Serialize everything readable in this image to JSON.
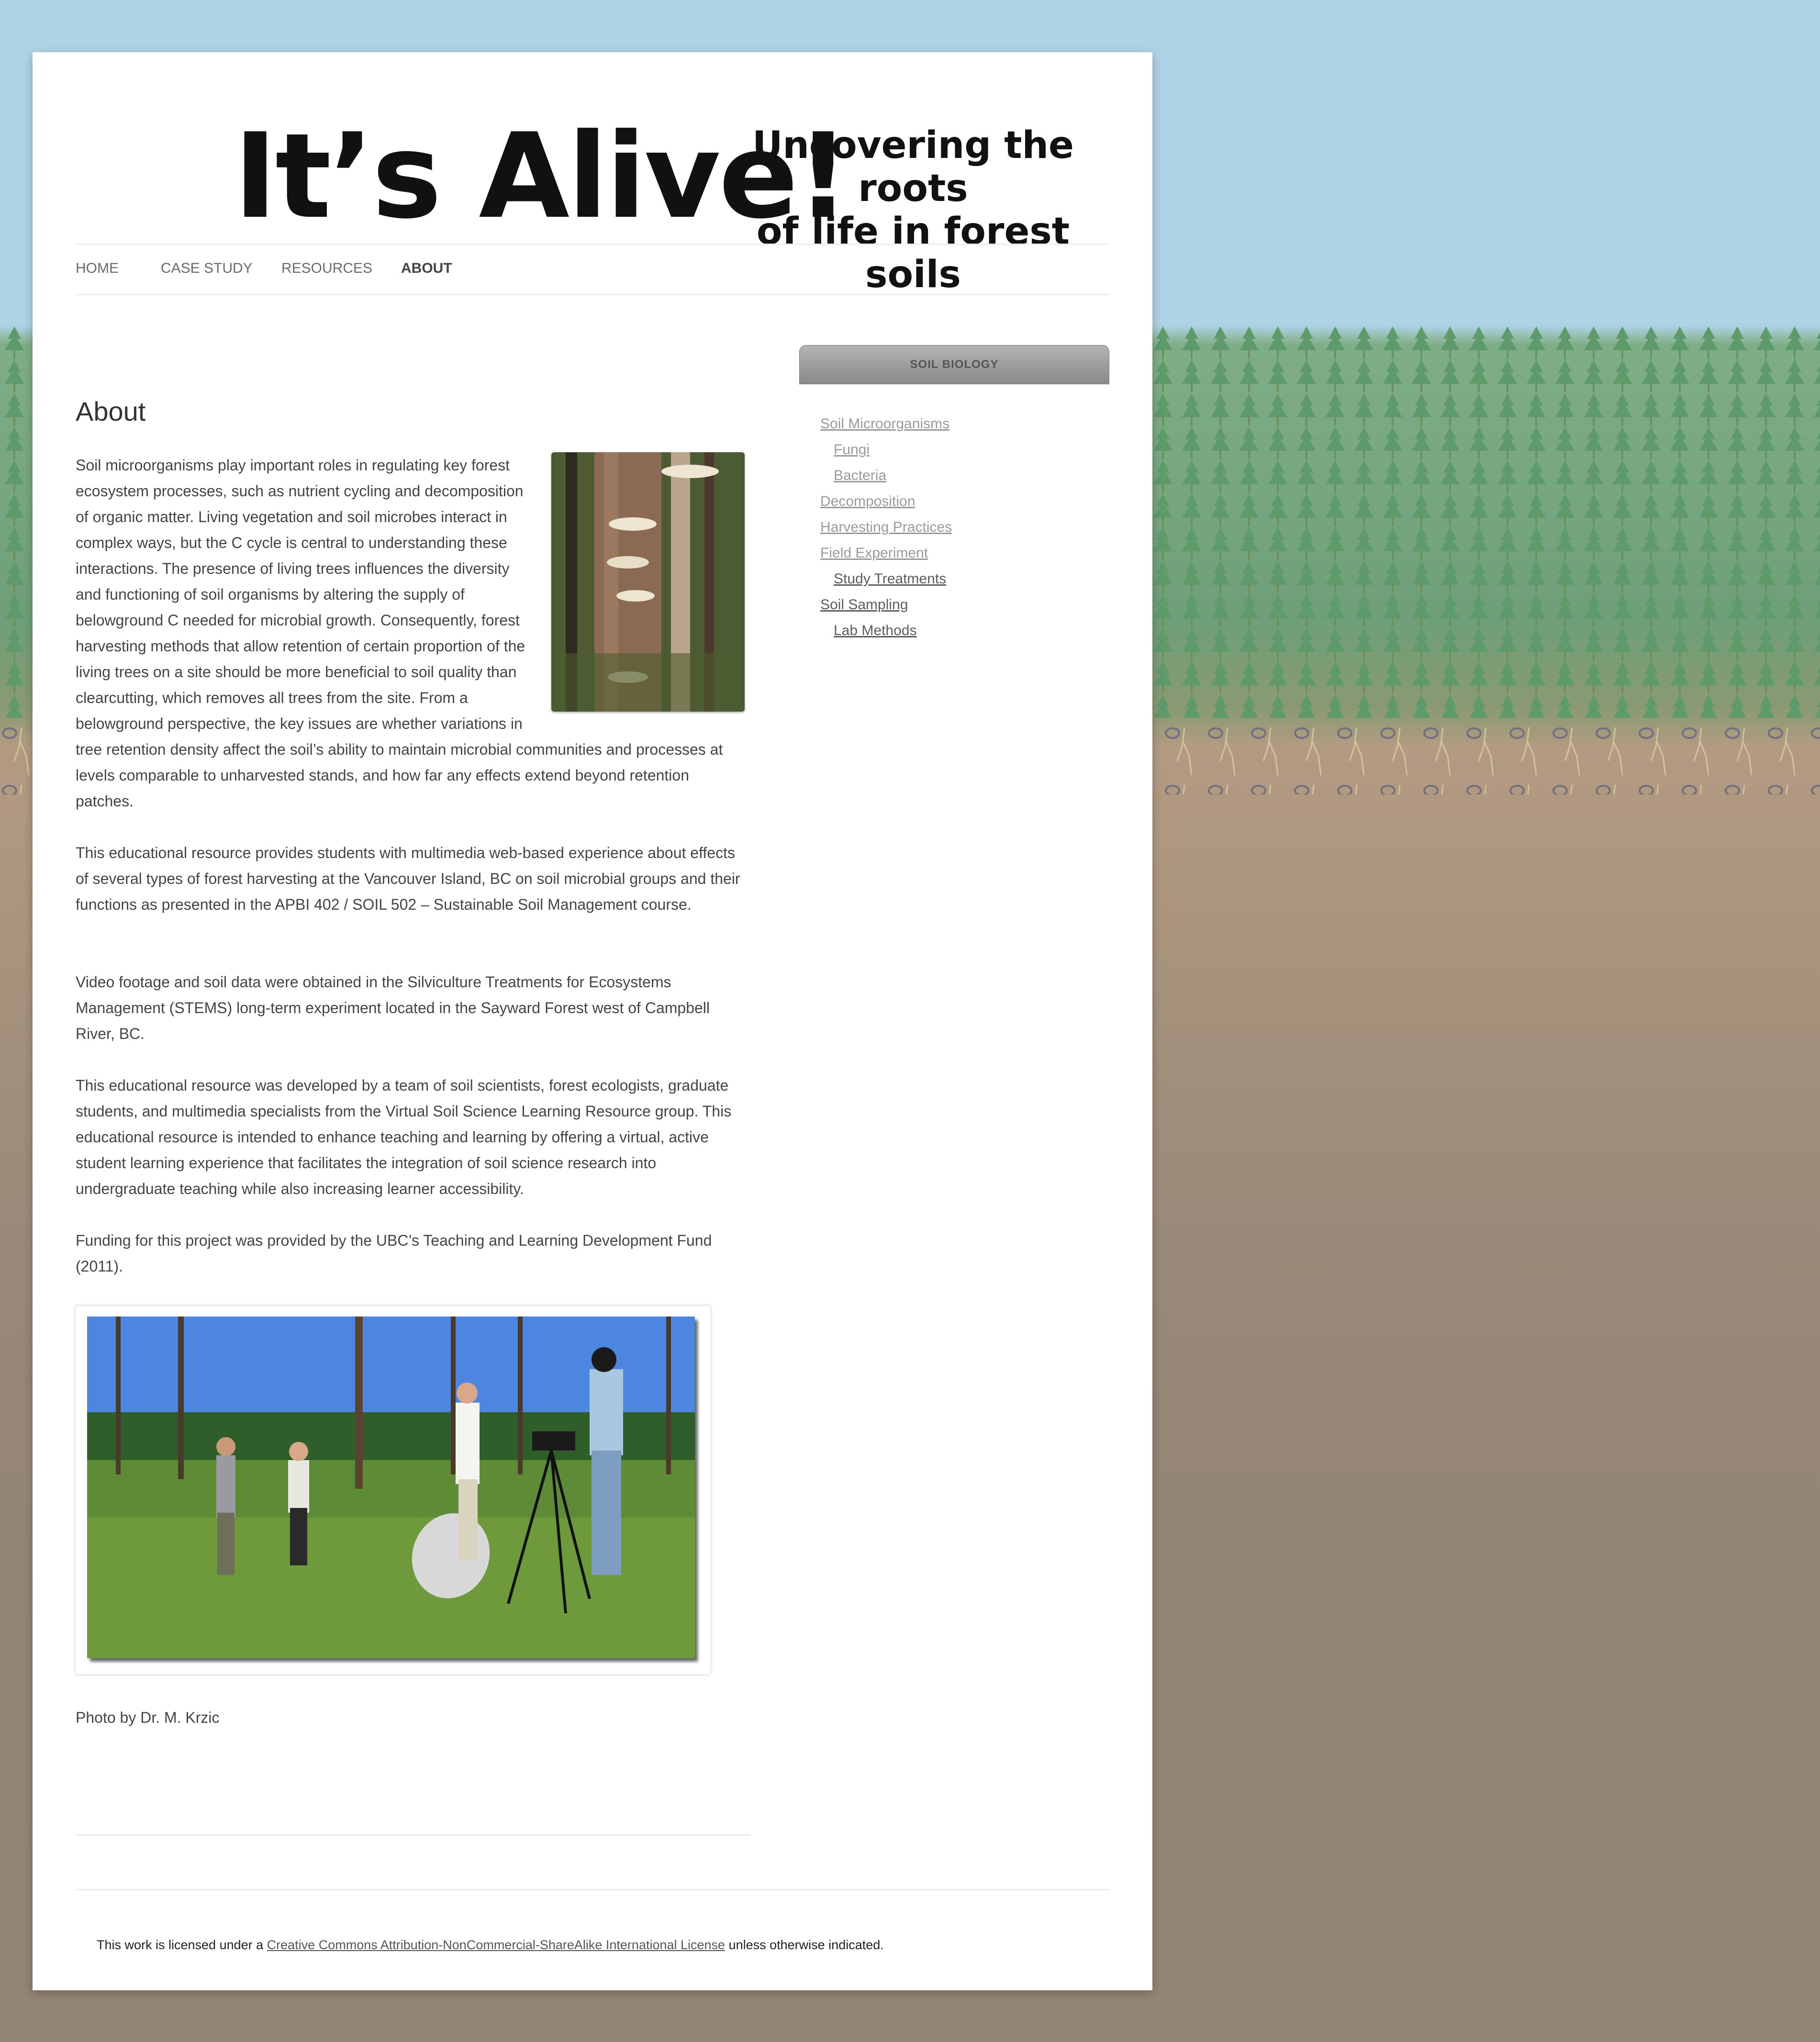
{
  "header": {
    "logo_main": "It’s Alive!",
    "logo_tagline_line1": "Uncovering the roots",
    "logo_tagline_line2": "of life in forest soils"
  },
  "nav": {
    "items": [
      {
        "label": "HOME"
      },
      {
        "label": "CASE STUDY"
      },
      {
        "label": "RESOURCES"
      },
      {
        "label": "ABOUT",
        "active": true
      }
    ]
  },
  "main": {
    "title": "About",
    "paragraphs": [
      "Soil microorganisms play important roles in regulating key forest ecosystem processes, such as nutrient cycling and decomposition of organic matter. Living vegetation and soil microbes interact in complex ways, but the C cycle is central to understanding these interactions.  The presence of living trees influences the diversity and functioning of soil organisms by altering the supply of belowground C needed for microbial growth. Consequently, forest harvesting methods that allow retention of certain proportion of the living trees on a site should be more beneficial to soil quality than clearcutting, which removes all trees from the site. From a belowground perspective, the key issues are whether variations in tree retention density affect the soil’s ability to maintain microbial communities and processes at levels comparable to unharvested stands, and how far any effects extend beyond retention patches.",
      "This educational resource provides students with multimedia web-based experience about effects of several types of forest harvesting at the Vancouver Island, BC on soil microbial groups and their functions as presented in the APBI 402 / SOIL 502 – Sustainable Soil Management course.",
      "Video footage and soil data were obtained in the Silviculture Treatments for Ecosystems Management (STEMS) long-term experiment located in the Sayward Forest west of Campbell River, BC.",
      "This educational resource was developed by a team of soil scientists, forest ecologists, graduate students, and multimedia specialists from the Virtual Soil Science Learning Resource group. This educational resource is intended to enhance teaching and learning by offering a virtual, active student learning experience that facilitates the integration of soil science research into undergraduate teaching while also increasing learner accessibility.",
      "Funding for this project was provided by the UBC’s Teaching and Learning Development Fund (2011)."
    ],
    "photo_credit": "Photo by Dr. M. Krzic"
  },
  "sidebar": {
    "widget_title": "SOIL BIOLOGY",
    "items": [
      {
        "label": "Soil Microorganisms",
        "level": 0,
        "style": "faded"
      },
      {
        "label": "Fungi",
        "level": 1,
        "style": "faded"
      },
      {
        "label": "Bacteria",
        "level": 1,
        "style": "faded"
      },
      {
        "label": "Decomposition",
        "level": 0,
        "style": "faded"
      },
      {
        "label": "Harvesting Practices",
        "level": 0,
        "style": "faded"
      },
      {
        "label": "Field Experiment",
        "level": 0,
        "style": "faded"
      },
      {
        "label": "Study Treatments",
        "level": 1,
        "style": "dark"
      },
      {
        "label": "Soil Sampling",
        "level": 0,
        "style": "dark"
      },
      {
        "label": "Lab Methods",
        "level": 1,
        "style": "dark"
      }
    ]
  },
  "footer": {
    "prefix": "This work is licensed under a ",
    "link": "Creative Commons Attribution-NonCommercial-ShareAlike International License",
    "suffix": " unless otherwise indicated."
  },
  "colors": {
    "sky": "#aed3e5",
    "soil": "#928576",
    "forest": "#7fae86",
    "widget_header": "#9a9a9a"
  }
}
